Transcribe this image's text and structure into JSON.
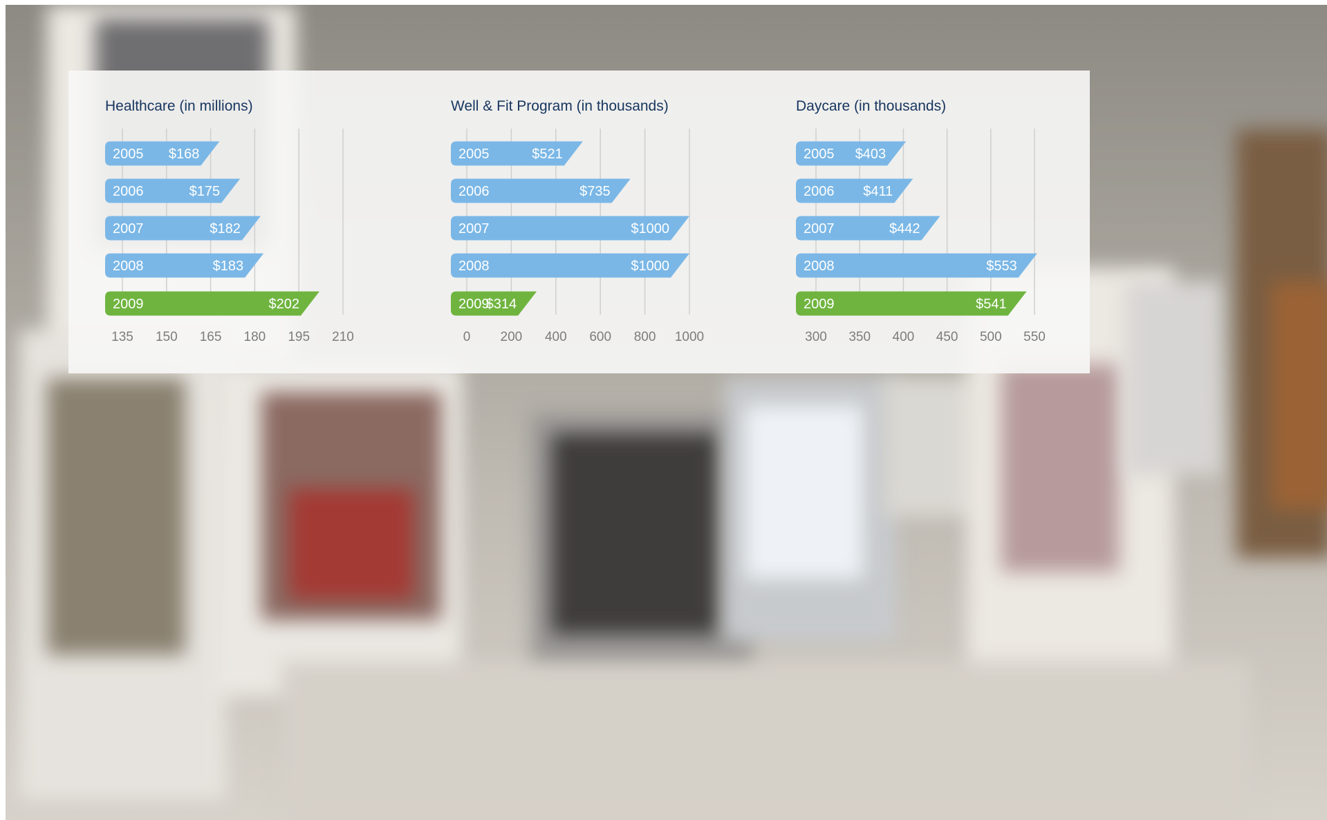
{
  "colors": {
    "bar_default": "#7ab7e6",
    "bar_highlight": "#6fb43f",
    "title": "#17355e",
    "grid": "#cfcfcf",
    "tick_label": "#7c7c7c",
    "bar_text": "#ffffff",
    "panel_bg": "#f6f6f5"
  },
  "background": {
    "description_icon": "photo-frames-background"
  },
  "chart_data": [
    {
      "type": "bar",
      "orientation": "horizontal",
      "title": "Healthcare (in millions)",
      "categories": [
        "2005",
        "2006",
        "2007",
        "2008",
        "2009"
      ],
      "values": [
        168,
        175,
        182,
        183,
        202
      ],
      "value_labels": [
        "$168",
        "$175",
        "$182",
        "$183",
        "$202"
      ],
      "highlight_index": 4,
      "xlim": [
        131,
        210
      ],
      "xticks": [
        135,
        150,
        165,
        180,
        195,
        210
      ],
      "grid": true
    },
    {
      "type": "bar",
      "orientation": "horizontal",
      "title": "Well & Fit Program (in thousands)",
      "categories": [
        "2005",
        "2006",
        "2007",
        "2008",
        "2009"
      ],
      "values": [
        521,
        735,
        1000,
        1000,
        314
      ],
      "value_labels": [
        "$521",
        "$735",
        "$1000",
        "$1000",
        "$314"
      ],
      "highlight_index": 4,
      "xlim": [
        -75,
        1000
      ],
      "xticks": [
        0,
        200,
        400,
        600,
        800,
        1000
      ],
      "grid": true
    },
    {
      "type": "bar",
      "orientation": "horizontal",
      "title": "Daycare (in thousands)",
      "categories": [
        "2005",
        "2006",
        "2007",
        "2008",
        "2009"
      ],
      "values": [
        403,
        411,
        442,
        553,
        541
      ],
      "value_labels": [
        "$403",
        "$411",
        "$442",
        "$553",
        "$541"
      ],
      "highlight_index": 4,
      "xlim": [
        280,
        550
      ],
      "xticks": [
        300,
        350,
        400,
        450,
        500,
        550
      ],
      "grid": true
    }
  ]
}
